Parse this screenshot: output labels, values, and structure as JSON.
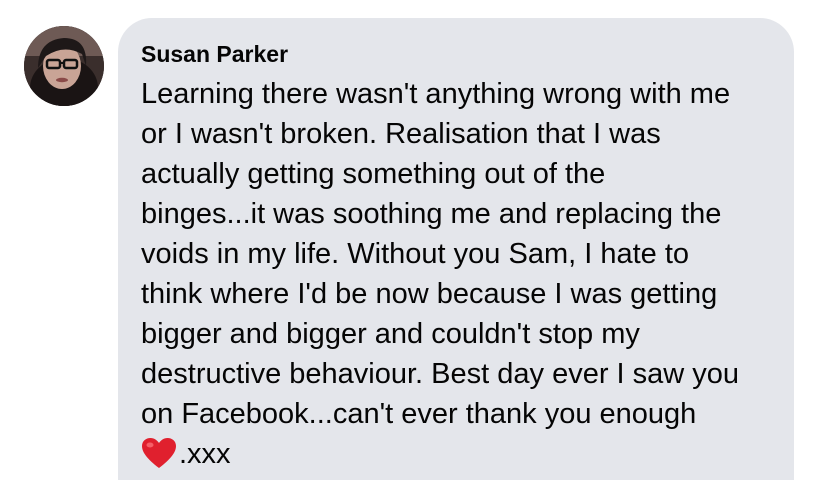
{
  "comment": {
    "author": "Susan Parker",
    "lines": [
      "Learning there wasn't anything wrong with me",
      "or I wasn't broken. Realisation that I was",
      "actually getting something out of the",
      "binges...it was soothing me and replacing the",
      "voids in my life. Without you Sam, I hate to",
      "think where I'd be now because I was getting",
      "bigger and bigger and couldn't stop my",
      "destructive behaviour. Best day ever I saw you",
      "on Facebook...can't ever thank you enough"
    ],
    "suffix": ".xxx",
    "emoji": "red-heart-icon"
  },
  "colors": {
    "bubble": "#e4e6eb",
    "text": "#050505",
    "heart": "#e0202e"
  }
}
